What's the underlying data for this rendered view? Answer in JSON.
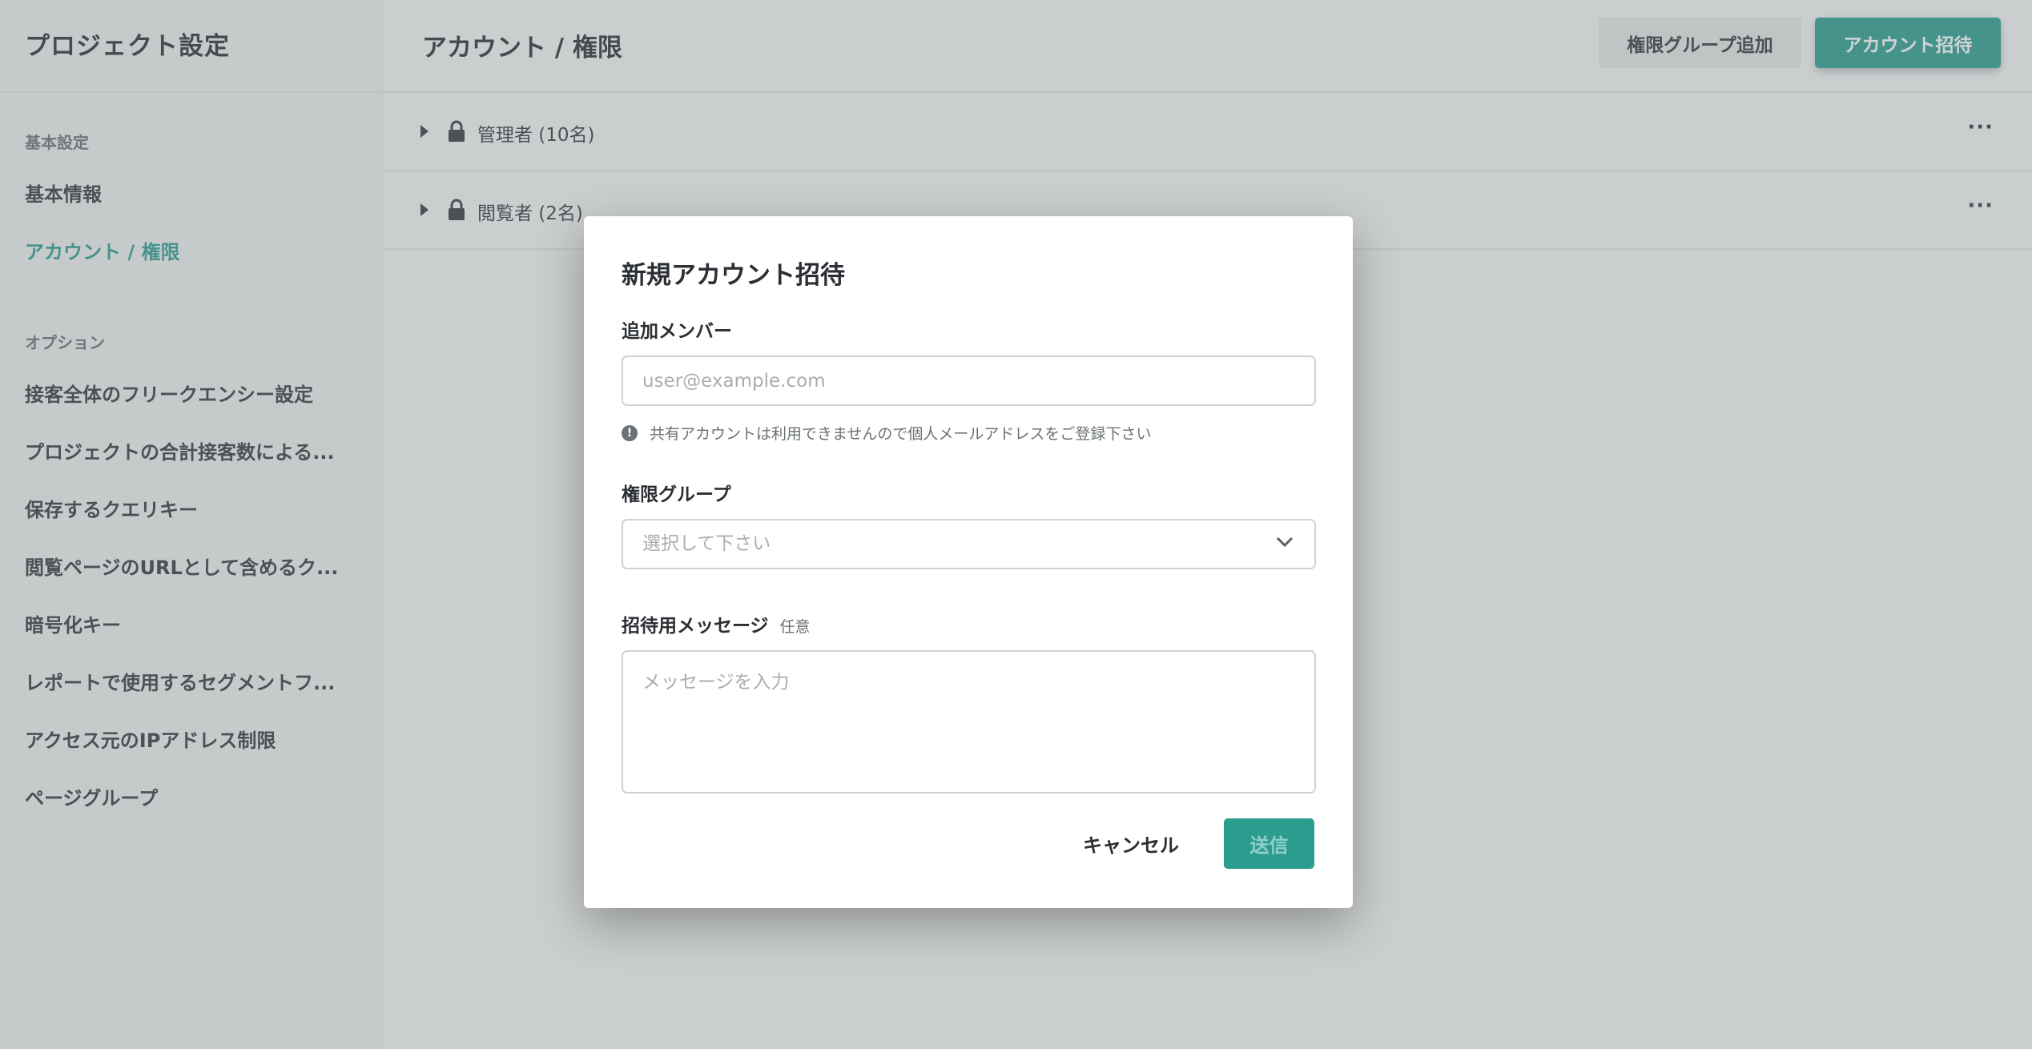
{
  "sidebar": {
    "title": "プロジェクト設定",
    "sections": [
      {
        "label": "基本設定",
        "items": [
          {
            "label": "基本情報",
            "active": false
          },
          {
            "label": "アカウント / 権限",
            "active": true
          }
        ]
      },
      {
        "label": "オプション",
        "items": [
          {
            "label": "接客全体のフリークエンシー設定"
          },
          {
            "label": "プロジェクトの合計接客数による..."
          },
          {
            "label": "保存するクエリキー"
          },
          {
            "label": "閲覧ページのURLとして含めるク..."
          },
          {
            "label": "暗号化キー"
          },
          {
            "label": "レポートで使用するセグメントフ..."
          },
          {
            "label": "アクセス元のIPアドレス制限"
          },
          {
            "label": "ページグループ"
          }
        ]
      }
    ]
  },
  "header": {
    "title": "アカウント / 権限",
    "add_group_label": "権限グループ追加",
    "invite_label": "アカウント招待"
  },
  "groups": [
    {
      "label": "管理者 (10名)",
      "more": "···"
    },
    {
      "label": "閲覧者 (2名)",
      "more": "···"
    }
  ],
  "modal": {
    "title": "新規アカウント招待",
    "member_label": "追加メンバー",
    "member_placeholder": "user@example.com",
    "hint": "共有アカウントは利用できませんので個人メールアドレスをご登録下さい",
    "hint_icon": "!",
    "group_label": "権限グループ",
    "group_placeholder": "選択して下さい",
    "message_label": "招待用メッセージ",
    "message_optional": "任意",
    "message_placeholder": "メッセージを入力",
    "cancel_label": "キャンセル",
    "send_label": "送信"
  },
  "colors": {
    "accent": "#2a9d8f"
  }
}
